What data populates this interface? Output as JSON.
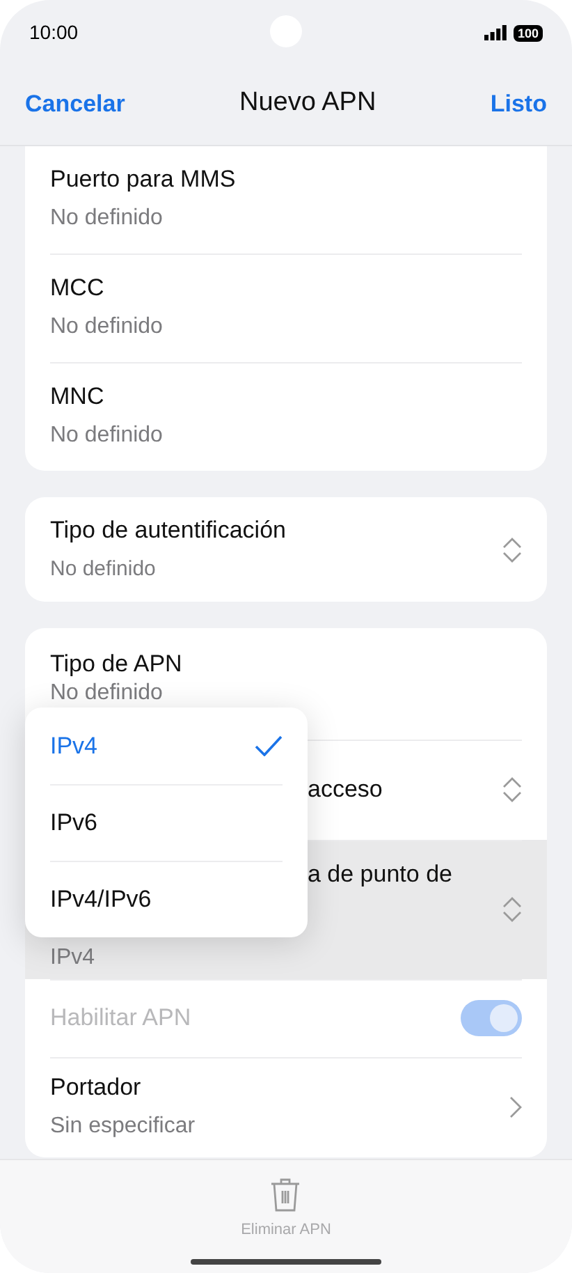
{
  "status_bar": {
    "time": "10:00",
    "battery": "100"
  },
  "nav": {
    "cancel": "Cancelar",
    "title": "Nuevo APN",
    "done": "Listo"
  },
  "groups": [
    {
      "items": [
        {
          "kind": "field",
          "title": "Puerto para MMS",
          "value": "No definido"
        },
        {
          "kind": "field",
          "title": "MCC",
          "value": "No definido"
        },
        {
          "kind": "field",
          "title": "MNC",
          "value": "No definido"
        }
      ]
    },
    {
      "items": [
        {
          "kind": "select",
          "title": "Tipo de autentificación",
          "value": "No definido"
        }
      ]
    },
    {
      "items": [
        {
          "kind": "field",
          "title": "Tipo de APN",
          "value": "No definido"
        },
        {
          "kind": "select_covered",
          "title": "acceso"
        },
        {
          "kind": "select_wrapped",
          "title": "a de punto de",
          "value": "IPv4",
          "highlighted": true
        },
        {
          "kind": "toggle",
          "title": "Habilitar APN",
          "on": true,
          "disabled": true
        },
        {
          "kind": "link",
          "title": "Portador",
          "value": "Sin especificar"
        }
      ]
    }
  ],
  "popup": {
    "options": [
      {
        "label": "IPv4",
        "selected": true
      },
      {
        "label": "IPv6",
        "selected": false
      },
      {
        "label": "IPv4/IPv6",
        "selected": false
      }
    ]
  },
  "bottom_bar": {
    "label": "Eliminar APN",
    "disabled": true
  }
}
